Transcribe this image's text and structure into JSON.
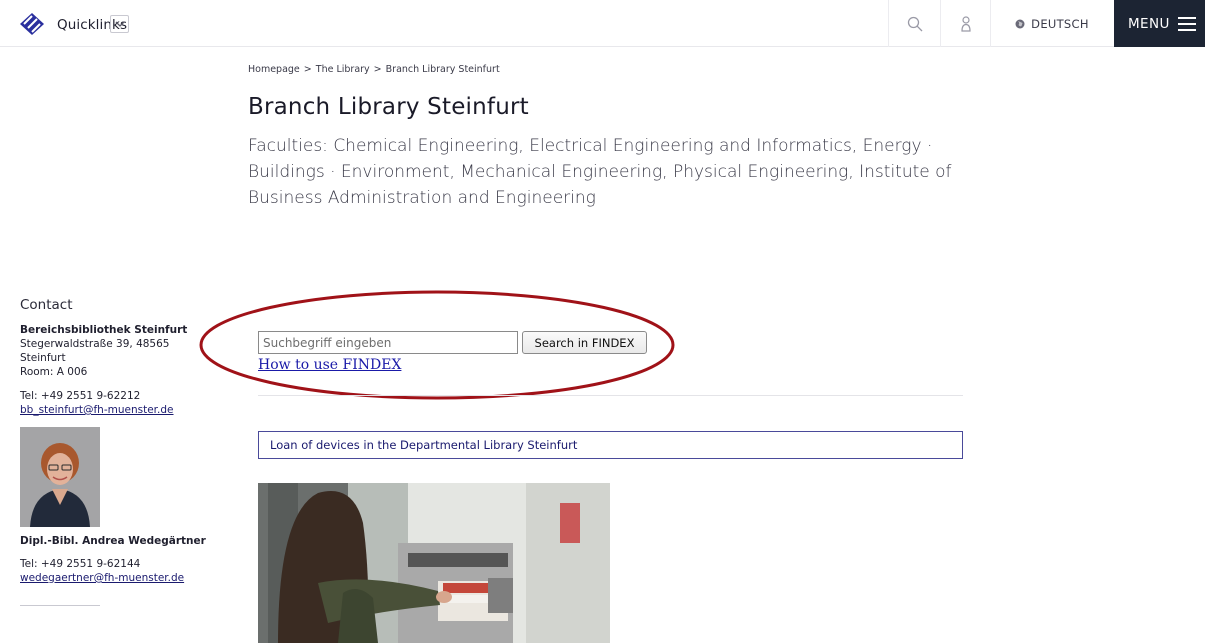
{
  "topbar": {
    "quicklinks_label": "Quicklinks",
    "language_label": "DEUTSCH",
    "menu_label": "MENU"
  },
  "breadcrumb": {
    "items": [
      "Homepage",
      "The Library",
      "Branch Library Steinfurt"
    ],
    "separator": ">"
  },
  "page": {
    "title": "Branch Library Steinfurt",
    "subtitle": "Faculties: Chemical Engineering, Electrical Engineering and Informatics, Energy · Buildings · Environment, Mechanical Engineering, Physical Engineering, Institute of Business Administration and Engineering"
  },
  "contact": {
    "title": "Contact",
    "library_name": "Bereichsbibliothek Steinfurt",
    "address_line1": "Stegerwaldstraße 39, 48565",
    "address_line2": "Steinfurt",
    "room": "Room: A 006",
    "phone": "Tel: +49 2551 9-62212",
    "email": "bb_steinfurt@fh-muenster.de",
    "person_name": "Dipl.-Bibl. Andrea Wedegärtner",
    "person_phone": "Tel: +49 2551 9-62144",
    "person_email": "wedegaertner@fh-muenster.de"
  },
  "findex": {
    "placeholder": "Suchbegriff eingeben",
    "button_label": "Search in FINDEX",
    "howto_label": "How to use FINDEX"
  },
  "loan_box": {
    "label": "Loan of devices in the Departmental Library Steinfurt"
  },
  "colors": {
    "menu_bg": "#1c2433",
    "logo": "#2a2f9e",
    "highlight": "#a01218",
    "link": "#1a1aa8"
  }
}
